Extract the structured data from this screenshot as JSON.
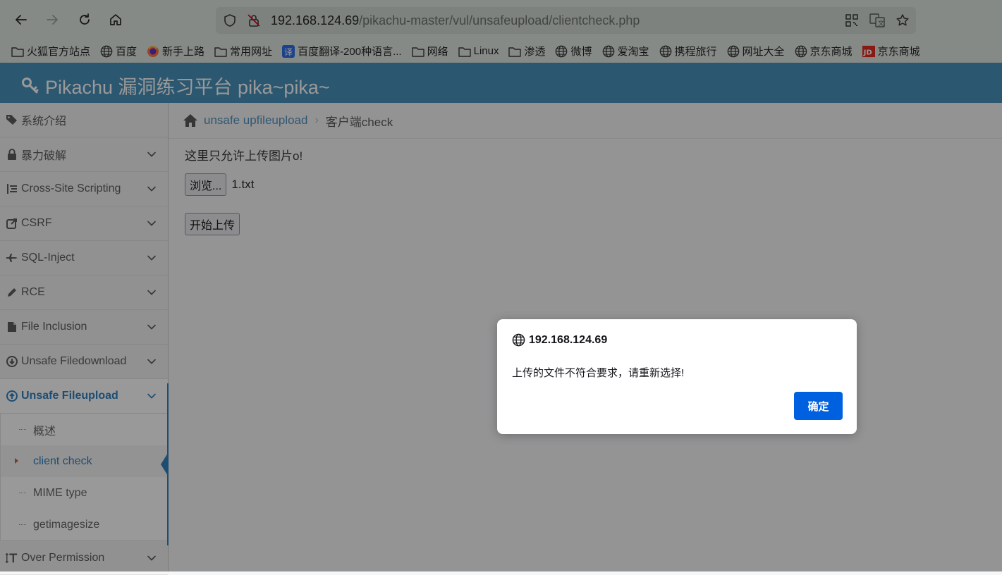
{
  "browser": {
    "url_host": "192.168.124.69",
    "url_path": "/pikachu-master/vul/unsafeupload/clientcheck.php",
    "bookmarks": [
      {
        "label": "火狐官方站点",
        "icon": "folder-icon"
      },
      {
        "label": "百度",
        "icon": "globe-icon"
      },
      {
        "label": "新手上路",
        "icon": "firefox-icon"
      },
      {
        "label": "常用网址",
        "icon": "folder-icon"
      },
      {
        "label": "百度翻译-200种语言...",
        "icon": "translate-icon"
      },
      {
        "label": "网络",
        "icon": "folder-icon"
      },
      {
        "label": "Linux",
        "icon": "folder-icon"
      },
      {
        "label": "渗透",
        "icon": "folder-icon"
      },
      {
        "label": "微博",
        "icon": "globe-icon"
      },
      {
        "label": "爱淘宝",
        "icon": "globe-icon"
      },
      {
        "label": "携程旅行",
        "icon": "globe-icon"
      },
      {
        "label": "网址大全",
        "icon": "globe-icon"
      },
      {
        "label": "京东商城",
        "icon": "globe-icon"
      },
      {
        "label": "京东商城",
        "icon": "jd-icon"
      }
    ]
  },
  "site": {
    "title": "Pikachu 漏洞练习平台 pika~pika~",
    "header_color": "#438eb9"
  },
  "sidebar": {
    "items": [
      {
        "label": "系统介绍",
        "icon": "tags-icon",
        "has_chevron": false
      },
      {
        "label": "暴力破解",
        "icon": "lock-icon",
        "has_chevron": true
      },
      {
        "label": "Cross-Site Scripting",
        "icon": "list-icon",
        "has_chevron": true
      },
      {
        "label": "CSRF",
        "icon": "share-icon",
        "has_chevron": true
      },
      {
        "label": "SQL-Inject",
        "icon": "fighter-jet-icon",
        "has_chevron": true
      },
      {
        "label": "RCE",
        "icon": "pencil-icon",
        "has_chevron": true
      },
      {
        "label": "File Inclusion",
        "icon": "file-icon",
        "has_chevron": true
      },
      {
        "label": "Unsafe Filedownload",
        "icon": "download-icon",
        "has_chevron": true
      },
      {
        "label": "Unsafe Fileupload",
        "icon": "upload-icon",
        "has_chevron": true,
        "active": true
      }
    ],
    "subitems": [
      {
        "label": "概述"
      },
      {
        "label": "client check",
        "current": true
      },
      {
        "label": "MIME type"
      },
      {
        "label": "getimagesize"
      }
    ],
    "last_item": {
      "label": "Over Permission",
      "icon": "text-height-icon"
    }
  },
  "breadcrumb": {
    "link": "unsafe upfileupload",
    "current": "客户端check"
  },
  "content": {
    "message": "这里只允许上传图片o!",
    "browse_label": "浏览...",
    "file_name": "1.txt",
    "submit_label": "开始上传"
  },
  "dialog": {
    "origin": "192.168.124.69",
    "message": "上传的文件不符合要求，请重新选择!",
    "ok_label": "确定",
    "ok_color": "#0061e0"
  }
}
